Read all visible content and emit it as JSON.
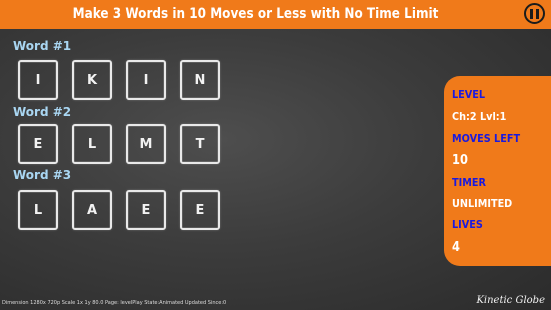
{
  "header": {
    "title": "Make 3 Words in 10 Moves or Less with No Time Limit",
    "pause_icon": "pause-icon"
  },
  "words": [
    {
      "label": "Word #1",
      "letters": [
        "I",
        "K",
        "I",
        "N"
      ]
    },
    {
      "label": "Word #2",
      "letters": [
        "E",
        "L",
        "M",
        "T"
      ]
    },
    {
      "label": "Word #3",
      "letters": [
        "L",
        "A",
        "E",
        "E"
      ]
    }
  ],
  "panel": {
    "level_label": "LEVEL",
    "level_value": "Ch:2 Lvl:1",
    "moves_label": "MOVES LEFT",
    "moves_value": "10",
    "timer_label": "TIMER",
    "timer_value": "UNLIMITED",
    "lives_label": "LIVES",
    "lives_value": "4"
  },
  "footer": {
    "debug_text": "Dimension 1280x 720p Scale 1x 1y 80.0 Page: levelPlay State:Animated Updated Since:0",
    "brand": "Kinetic Globe"
  },
  "colors": {
    "accent": "#f07a1a",
    "label_blue": "#1a1ae0",
    "word_label": "#a9d6f2",
    "background": "#3c3c3c"
  }
}
